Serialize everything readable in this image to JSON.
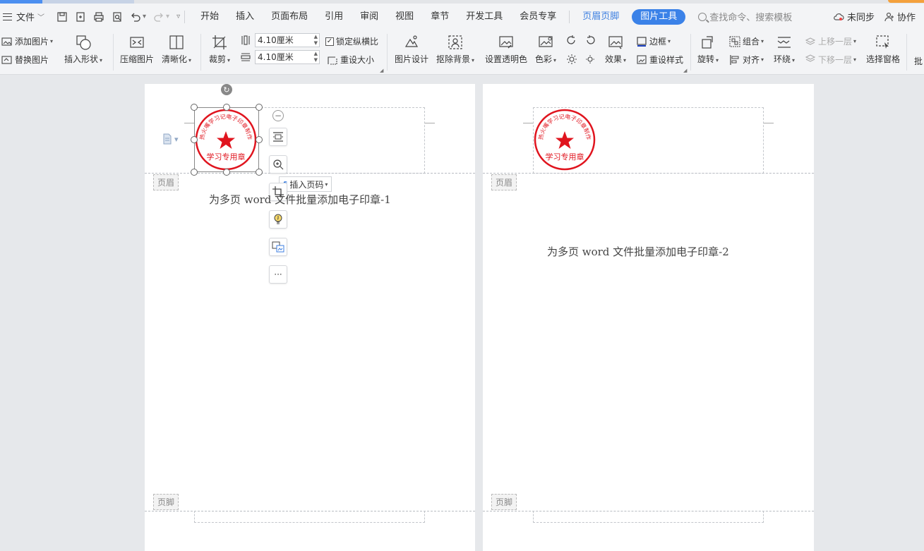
{
  "menubar": {
    "file_label": "文件",
    "tabs": [
      "开始",
      "插入",
      "页面布局",
      "引用",
      "审阅",
      "视图",
      "章节",
      "开发工具",
      "会员专享"
    ],
    "header_footer_tab": "页眉页脚",
    "picture_tools_tab": "图片工具",
    "search_placeholder": "查找命令、搜索模板",
    "sync_label": "未同步",
    "collab_label": "协作"
  },
  "ribbon": {
    "add_picture": "添加图片",
    "replace_picture": "替换图片",
    "insert_shape": "插入形状",
    "compress_picture": "压缩图片",
    "sharpen": "清晰化",
    "crop": "裁剪",
    "height_value": "4.10厘米",
    "width_value": "4.10厘米",
    "lock_ratio": "锁定纵横比",
    "reset_size": "重设大小",
    "picture_design": "图片设计",
    "remove_bg": "抠除背景",
    "set_transparent": "设置透明色",
    "color": "色彩",
    "effects": "效果",
    "border": "边框",
    "reset_style": "重设样式",
    "rotate": "旋转",
    "group": "组合",
    "align": "对齐",
    "wrap": "环绕",
    "bring_forward": "上移一层",
    "send_backward": "下移一层",
    "selection_pane": "选择窗格",
    "batch": "批"
  },
  "pages": [
    {
      "header_tag": "页眉",
      "footer_tag": "页脚",
      "body_text": "为多页 word 文件批量添加电子印章-1"
    },
    {
      "header_tag": "页眉",
      "footer_tag": "页脚",
      "body_text": "为多页 word 文件批量添加电子印章-2"
    }
  ],
  "stamp": {
    "arc_text": "热火嘴学习记电子印章制作",
    "center_text": "学习专用章",
    "color": "#e0141e"
  },
  "float_toolbar": {
    "insert_page_number": "插入页码",
    "more": "···"
  },
  "colors": {
    "accent": "#3b82e8",
    "toolbar_bg": "#f3f4f6",
    "canvas_bg": "#e6e8eb"
  }
}
